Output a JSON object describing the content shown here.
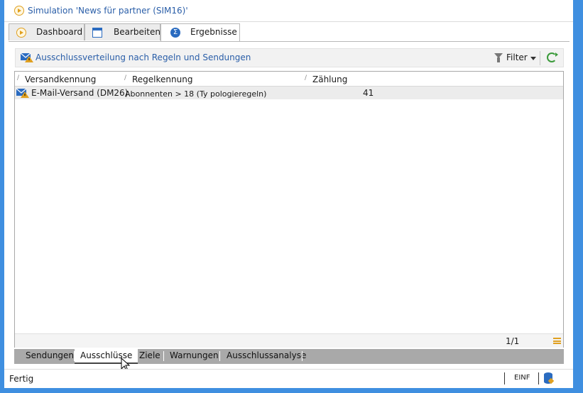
{
  "window": {
    "title": "Simulation 'News für partner (SIM16)'"
  },
  "tabs": [
    {
      "label": "Dashboard",
      "icon": "play-icon",
      "active": false
    },
    {
      "label": "Bearbeiten",
      "icon": "edit-window-icon",
      "active": false
    },
    {
      "label": "Ergebnisse",
      "icon": "sigma-icon",
      "active": true
    }
  ],
  "toolbar": {
    "title": "Ausschlussverteilung nach Regeln und Sendungen",
    "title_icon": "mail-warning-icon",
    "filter_label": "Filter",
    "refresh_icon": "refresh-icon"
  },
  "grid": {
    "columns": [
      "Versandkennung",
      "Regelkennung",
      "Zählung"
    ],
    "rows": [
      {
        "versand": "E-Mail-Versand (DM26)",
        "regel": "Abonnenten > 18 (Ty pologieregeln)",
        "zaehlung": "41",
        "icon": "mail-warning-icon"
      }
    ],
    "pager": "1/1"
  },
  "bottom_tabs": [
    {
      "label": "Sendungen",
      "active": false
    },
    {
      "label": "Ausschlüsse",
      "active": true
    },
    {
      "label": "Ziele",
      "active": false
    },
    {
      "label": "Warnungen",
      "active": false
    },
    {
      "label": "Ausschlussanalyse",
      "active": false
    }
  ],
  "status": {
    "text": "Fertig",
    "mode": "EINF"
  },
  "colors": {
    "frame": "#3f8fe0",
    "link": "#2a5ea8",
    "accent": "#2a6bc0",
    "warning": "#e0a020",
    "refresh": "#3a9a3a"
  }
}
